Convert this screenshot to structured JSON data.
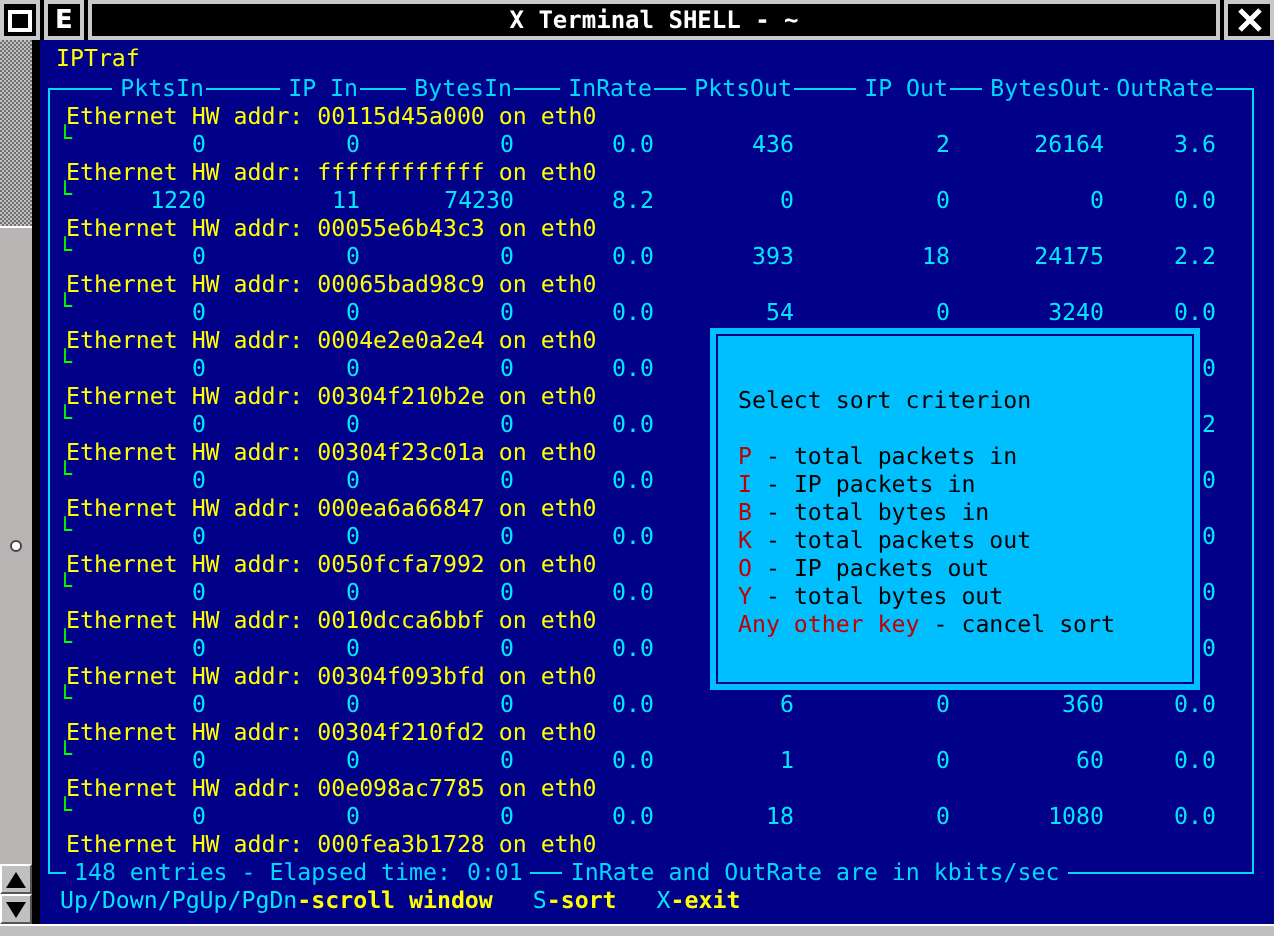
{
  "window": {
    "title": "X Terminal SHELL - ~",
    "menu_button": "E"
  },
  "app_title": "IPTraf",
  "table": {
    "columns": [
      "PktsIn",
      "IP In",
      "BytesIn",
      "InRate",
      "PktsOut",
      "IP Out",
      "BytesOut",
      "OutRate"
    ],
    "rows": [
      {
        "host": "Ethernet HW addr: 00115d45a000 on eth0",
        "branch": "└",
        "values": {
          "pkts_in": "0",
          "ip_in": "0",
          "bytes_in": "0",
          "in_rate": "0.0",
          "pkts_out": "436",
          "ip_out": "2",
          "bytes_out": "26164",
          "out_rate": "3.6"
        }
      },
      {
        "host": "Ethernet HW addr: ffffffffffff on eth0",
        "branch": "└",
        "values": {
          "pkts_in": "1220",
          "ip_in": "11",
          "bytes_in": "74230",
          "in_rate": "8.2",
          "pkts_out": "0",
          "ip_out": "0",
          "bytes_out": "0",
          "out_rate": "0.0"
        }
      },
      {
        "host": "Ethernet HW addr: 00055e6b43c3 on eth0",
        "branch": "└",
        "values": {
          "pkts_in": "0",
          "ip_in": "0",
          "bytes_in": "0",
          "in_rate": "0.0",
          "pkts_out": "393",
          "ip_out": "18",
          "bytes_out": "24175",
          "out_rate": "2.2"
        }
      },
      {
        "host": "Ethernet HW addr: 00065bad98c9 on eth0",
        "branch": "└",
        "values": {
          "pkts_in": "0",
          "ip_in": "0",
          "bytes_in": "0",
          "in_rate": "0.0",
          "pkts_out": "54",
          "ip_out": "0",
          "bytes_out": "3240",
          "out_rate": "0.0"
        }
      },
      {
        "host": "Ethernet HW addr: 0004e2e0a2e4 on eth0",
        "branch": "└",
        "values": {
          "pkts_in": "0",
          "ip_in": "0",
          "bytes_in": "0",
          "in_rate": "0.0",
          "out_rate": "0"
        }
      },
      {
        "host": "Ethernet HW addr: 00304f210b2e on eth0",
        "branch": "└",
        "values": {
          "pkts_in": "0",
          "ip_in": "0",
          "bytes_in": "0",
          "in_rate": "0.0",
          "out_rate": "2"
        }
      },
      {
        "host": "Ethernet HW addr: 00304f23c01a on eth0",
        "branch": "└",
        "values": {
          "pkts_in": "0",
          "ip_in": "0",
          "bytes_in": "0",
          "in_rate": "0.0",
          "out_rate": "0"
        }
      },
      {
        "host": "Ethernet HW addr: 000ea6a66847 on eth0",
        "branch": "└",
        "values": {
          "pkts_in": "0",
          "ip_in": "0",
          "bytes_in": "0",
          "in_rate": "0.0",
          "out_rate": "0"
        }
      },
      {
        "host": "Ethernet HW addr: 0050fcfa7992 on eth0",
        "branch": "└",
        "values": {
          "pkts_in": "0",
          "ip_in": "0",
          "bytes_in": "0",
          "in_rate": "0.0",
          "out_rate": "0"
        }
      },
      {
        "host": "Ethernet HW addr: 0010dcca6bbf on eth0",
        "branch": "└",
        "values": {
          "pkts_in": "0",
          "ip_in": "0",
          "bytes_in": "0",
          "in_rate": "0.0",
          "out_rate": "0"
        }
      },
      {
        "host": "Ethernet HW addr: 00304f093bfd on eth0",
        "branch": "└",
        "values": {
          "pkts_in": "0",
          "ip_in": "0",
          "bytes_in": "0",
          "in_rate": "0.0",
          "pkts_out": "6",
          "ip_out": "0",
          "bytes_out": "360",
          "out_rate": "0.0"
        }
      },
      {
        "host": "Ethernet HW addr: 00304f210fd2 on eth0",
        "branch": "└",
        "values": {
          "pkts_in": "0",
          "ip_in": "0",
          "bytes_in": "0",
          "in_rate": "0.0",
          "pkts_out": "1",
          "ip_out": "0",
          "bytes_out": "60",
          "out_rate": "0.0"
        }
      },
      {
        "host": "Ethernet HW addr: 00e098ac7785 on eth0",
        "branch": "└",
        "values": {
          "pkts_in": "0",
          "ip_in": "0",
          "bytes_in": "0",
          "in_rate": "0.0",
          "pkts_out": "18",
          "ip_out": "0",
          "bytes_out": "1080",
          "out_rate": "0.0"
        }
      },
      {
        "host": "Ethernet HW addr: 000fea3b1728 on eth0"
      }
    ]
  },
  "status": {
    "entries": "148 entries - Elapsed time:",
    "elapsed": "0:01",
    "note": "InRate and OutRate are in kbits/sec"
  },
  "help": [
    {
      "key": "Up/Down/PgUp/PgDn",
      "action": "-scroll window"
    },
    {
      "key": "S",
      "action": "-sort"
    },
    {
      "key": "X",
      "action": "-exit"
    }
  ],
  "sort_dialog": {
    "title": "Select sort criterion",
    "options": [
      {
        "key": "P",
        "label": "- total packets in"
      },
      {
        "key": "I",
        "label": "- IP packets in"
      },
      {
        "key": "B",
        "label": "- total bytes in"
      },
      {
        "key": "K",
        "label": "- total packets out"
      },
      {
        "key": "O",
        "label": "- IP packets out"
      },
      {
        "key": "Y",
        "label": "- total bytes out"
      },
      {
        "key": "Any other key",
        "label": "- cancel sort"
      }
    ]
  }
}
